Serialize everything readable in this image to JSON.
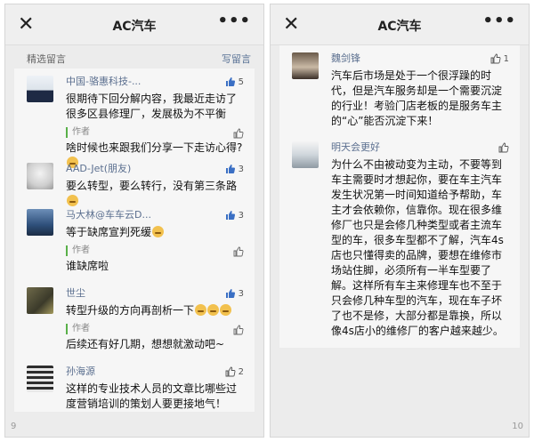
{
  "left": {
    "close_icon": "close-icon",
    "title": "AC汽车",
    "more": "•••",
    "section_title": "精选留言",
    "write_label": "写留言",
    "page_number": "9",
    "comments": [
      {
        "author": "中国-骆惠科技-...",
        "likes": "5",
        "liked": true,
        "text": "很期待下回分解内容，我最近走访了很多区县修理厂，发展极为不平衡",
        "reply_tag": "作者",
        "reply": "啥时候也来跟我们分享一下走访心得?"
      },
      {
        "author": "AAD-Jet(朋友)",
        "likes": "3",
        "liked": true,
        "text": "要么转型，要么转行，没有第三条路"
      },
      {
        "author": "马大林@车车云D...",
        "likes": "3",
        "liked": true,
        "text": "等于缺席宣判死缓",
        "reply_tag": "作者",
        "reply": "谁缺席啦"
      },
      {
        "author": "世尘",
        "likes": "3",
        "liked": true,
        "text": "转型升级的方向再剖析一下",
        "reply_tag": "作者",
        "reply": "后续还有好几期，想想就激动吧~"
      },
      {
        "author": "孙海源",
        "likes": "2",
        "liked": false,
        "text": "这样的专业技术人员的文章比哪些过度营销培训的策划人要更接地气！"
      }
    ]
  },
  "right": {
    "title": "AC汽车",
    "more": "•••",
    "page_number": "10",
    "comments": [
      {
        "author": "魏剑锋",
        "likes": "1",
        "liked": false,
        "text": "汽车后市场是处于一个很浮躁的时代，但是汽车服务却是一个需要沉淀的行业！考验门店老板的是服务车主的“心”能否沉淀下来！"
      },
      {
        "author": "明天会更好",
        "likes": "",
        "liked": false,
        "text": "为什么不由被动变为主动，不要等到车主需要时才想起你，要在车主汽车发生状况第一时间知道给予帮助，车主才会依赖你，信靠你。现在很多维修厂也只是会修几种类型或者主流车型的车，很多车型都不了解，汽车4s店也只懂得卖的品牌，要想在维修市场站住脚，必须所有一半车型要了解。这样所有车主来修理车也不至于只会修几种车型的汽车，现在车子坏了也不是修，大部分都是靠换，所以像4s店小的维修厂的客户越来越少。"
      }
    ]
  },
  "colors": {
    "like_active": "#3a6fc4",
    "like_inactive": "#555555",
    "author": "#5b6f8f",
    "reply_bar": "#59b049"
  }
}
